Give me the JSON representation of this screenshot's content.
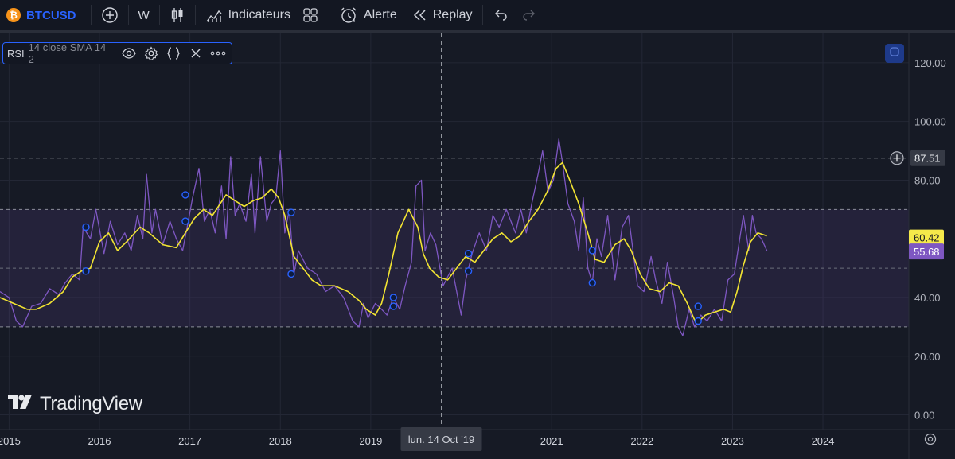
{
  "toolbar": {
    "symbol": "BTCUSD",
    "symbol_logo": "₿",
    "interval": "W",
    "indicators_label": "Indicateurs",
    "alert_label": "Alerte",
    "replay_label": "Replay"
  },
  "legend": {
    "name": "RSI",
    "args": "14 close SMA 14 2"
  },
  "watermark": "TradingView",
  "crosshair": {
    "date_label": "lun. 14 Oct '19",
    "price_label": "87.51"
  },
  "colors": {
    "background": "#161a25",
    "rsi_line": "#7e57c2",
    "ma_line": "#f3e532",
    "band": "#7e57c2",
    "rsi_tag": "#7e57c2",
    "ma_tag": "#f5e94a",
    "accent": "#2962ff"
  },
  "chart_data": {
    "type": "line",
    "ylim": [
      -5,
      130
    ],
    "yticks": [
      "120.00",
      "100.00",
      "80.00",
      "40.00",
      "20.00",
      "0.00"
    ],
    "xticks": [
      "2015",
      "2016",
      "2017",
      "2018",
      "2019",
      "2021",
      "2022",
      "2023",
      "2024"
    ],
    "xlim_years": [
      2014.9,
      2024.95
    ],
    "band": {
      "upper": 70,
      "middle": 50,
      "lower": 30
    },
    "crosshair_value": 87.51,
    "last_values": {
      "ma": "60.42",
      "rsi": "55.68"
    },
    "series": [
      {
        "key": "rsi",
        "x": [
          2014.9,
          2015.0,
          2015.08,
          2015.15,
          2015.25,
          2015.35,
          2015.45,
          2015.55,
          2015.62,
          2015.7,
          2015.78,
          2015.82,
          2015.9,
          2015.96,
          2016.05,
          2016.12,
          2016.2,
          2016.28,
          2016.35,
          2016.42,
          2016.48,
          2016.52,
          2016.58,
          2016.62,
          2016.7,
          2016.78,
          2016.85,
          2016.92,
          2016.97,
          2017.03,
          2017.1,
          2017.16,
          2017.22,
          2017.28,
          2017.35,
          2017.4,
          2017.45,
          2017.5,
          2017.55,
          2017.62,
          2017.68,
          2017.72,
          2017.78,
          2017.85,
          2017.9,
          2017.95,
          2018.0,
          2018.05,
          2018.1,
          2018.15,
          2018.2,
          2018.3,
          2018.4,
          2018.5,
          2018.6,
          2018.7,
          2018.8,
          2018.87,
          2018.92,
          2018.97,
          2019.05,
          2019.12,
          2019.18,
          2019.25,
          2019.32,
          2019.38,
          2019.45,
          2019.5,
          2019.56,
          2019.6,
          2019.66,
          2019.72,
          2019.8,
          2019.9,
          2020.0,
          2020.05,
          2020.12,
          2020.2,
          2020.28,
          2020.35,
          2020.42,
          2020.5,
          2020.55,
          2020.6,
          2020.66,
          2020.72,
          2020.78,
          2020.85,
          2020.9,
          2020.96,
          2021.02,
          2021.08,
          2021.12,
          2021.18,
          2021.25,
          2021.3,
          2021.35,
          2021.4,
          2021.45,
          2021.5,
          2021.55,
          2021.62,
          2021.7,
          2021.78,
          2021.85,
          2021.9,
          2021.95,
          2022.02,
          2022.1,
          2022.15,
          2022.22,
          2022.28,
          2022.35,
          2022.4,
          2022.45,
          2022.52,
          2022.58,
          2022.65,
          2022.72,
          2022.8,
          2022.88,
          2022.95,
          2023.02,
          2023.08,
          2023.12,
          2023.18,
          2023.22,
          2023.26,
          2023.32,
          2023.38
        ],
        "y": [
          42,
          40,
          32,
          30,
          37,
          38,
          43,
          41,
          45,
          48,
          46,
          64,
          60,
          70,
          55,
          66,
          58,
          62,
          56,
          68,
          60,
          82,
          62,
          70,
          58,
          66,
          60,
          56,
          64,
          74,
          84,
          66,
          70,
          62,
          78,
          60,
          88,
          68,
          72,
          66,
          82,
          62,
          88,
          66,
          72,
          74,
          90,
          62,
          70,
          48,
          56,
          50,
          48,
          42,
          44,
          40,
          32,
          30,
          38,
          33,
          38,
          36,
          34,
          40,
          36,
          44,
          52,
          78,
          80,
          56,
          62,
          58,
          44,
          50,
          34,
          46,
          55,
          62,
          56,
          68,
          64,
          70,
          66,
          62,
          70,
          62,
          72,
          82,
          90,
          76,
          80,
          94,
          86,
          72,
          66,
          56,
          74,
          50,
          45,
          60,
          54,
          68,
          46,
          64,
          68,
          56,
          44,
          42,
          54,
          46,
          38,
          52,
          40,
          30,
          27,
          36,
          30,
          34,
          32,
          36,
          32,
          46,
          48,
          60,
          68,
          56,
          68,
          62,
          60,
          56
        ]
      },
      {
        "key": "ma",
        "x": [
          2014.9,
          2015.05,
          2015.2,
          2015.3,
          2015.45,
          2015.6,
          2015.7,
          2015.8,
          2015.9,
          2016.0,
          2016.1,
          2016.2,
          2016.3,
          2016.45,
          2016.55,
          2016.7,
          2016.85,
          2016.95,
          2017.05,
          2017.15,
          2017.25,
          2017.4,
          2017.5,
          2017.6,
          2017.7,
          2017.8,
          2017.9,
          2017.98,
          2018.05,
          2018.15,
          2018.25,
          2018.35,
          2018.45,
          2018.6,
          2018.75,
          2018.87,
          2018.95,
          2019.05,
          2019.12,
          2019.2,
          2019.3,
          2019.42,
          2019.52,
          2019.58,
          2019.65,
          2019.75,
          2019.85,
          2019.95,
          2020.05,
          2020.15,
          2020.25,
          2020.35,
          2020.45,
          2020.55,
          2020.65,
          2020.75,
          2020.85,
          2020.95,
          2021.05,
          2021.12,
          2021.2,
          2021.3,
          2021.4,
          2021.48,
          2021.58,
          2021.7,
          2021.8,
          2021.88,
          2021.98,
          2022.08,
          2022.2,
          2022.3,
          2022.4,
          2022.5,
          2022.6,
          2022.7,
          2022.8,
          2022.9,
          2022.98,
          2023.05,
          2023.12,
          2023.2,
          2023.28,
          2023.38
        ],
        "y": [
          40,
          38,
          36,
          36,
          38,
          42,
          47,
          49,
          50,
          59,
          62,
          56,
          59,
          64,
          62,
          58,
          57,
          62,
          67,
          70,
          68,
          75,
          73,
          71,
          73,
          74,
          77,
          74,
          68,
          54,
          50,
          46,
          44,
          44,
          42,
          39,
          36,
          34,
          38,
          48,
          62,
          70,
          64,
          55,
          50,
          47,
          46,
          50,
          54,
          52,
          56,
          60,
          62,
          59,
          61,
          66,
          70,
          76,
          84,
          86,
          80,
          72,
          62,
          53,
          52,
          58,
          60,
          56,
          48,
          43,
          42,
          45,
          44,
          38,
          31,
          34,
          35,
          36,
          35,
          42,
          51,
          59,
          62,
          61
        ]
      }
    ],
    "markers": [
      {
        "x": 2015.85,
        "y": 64
      },
      {
        "x": 2015.85,
        "y": 49
      },
      {
        "x": 2016.95,
        "y": 75
      },
      {
        "x": 2016.95,
        "y": 66
      },
      {
        "x": 2018.12,
        "y": 69
      },
      {
        "x": 2018.12,
        "y": 48
      },
      {
        "x": 2019.25,
        "y": 40
      },
      {
        "x": 2019.25,
        "y": 37
      },
      {
        "x": 2020.08,
        "y": 55
      },
      {
        "x": 2020.08,
        "y": 49
      },
      {
        "x": 2021.45,
        "y": 56
      },
      {
        "x": 2021.45,
        "y": 45
      },
      {
        "x": 2022.62,
        "y": 37
      },
      {
        "x": 2022.62,
        "y": 32
      }
    ]
  }
}
